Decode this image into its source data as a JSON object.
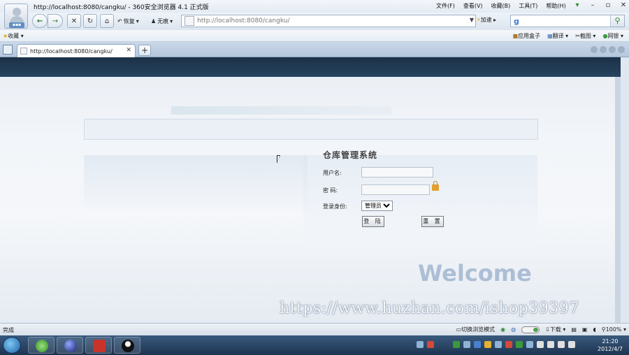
{
  "window": {
    "title": "http://localhost:8080/cangku/ - 360安全浏览器 4.1 正式版",
    "menu": [
      "文件(F)",
      "查看(V)",
      "收藏(B)",
      "工具(T)",
      "帮助(H)"
    ]
  },
  "toolbar": {
    "restore_label": "恢复",
    "no_trace_label": "无痕",
    "url": "http://localhost:8080/cangku/",
    "speed_label": "加速"
  },
  "favorites": {
    "label": "收藏",
    "right_items": [
      "应用盒子",
      "翻译",
      "截图",
      "网银"
    ]
  },
  "tab": {
    "title": "http://localhost:8080/cangku/"
  },
  "login": {
    "title": "仓库管理系统",
    "username_label": "用户名:",
    "password_label": "密 码:",
    "role_label": "登录身份:",
    "role_value": "管理员",
    "login_button": "登 陆",
    "reset_button": "重 置"
  },
  "page": {
    "welcome": "Welcome",
    "watermark": "https://www.huzhan.com/ishop39397"
  },
  "status": {
    "left": "完成",
    "mode_label": "切换浏览模式",
    "download_label": "下载",
    "zoom": "100%"
  },
  "taskbar": {
    "time": "21:20",
    "date": "2012/4/7"
  }
}
